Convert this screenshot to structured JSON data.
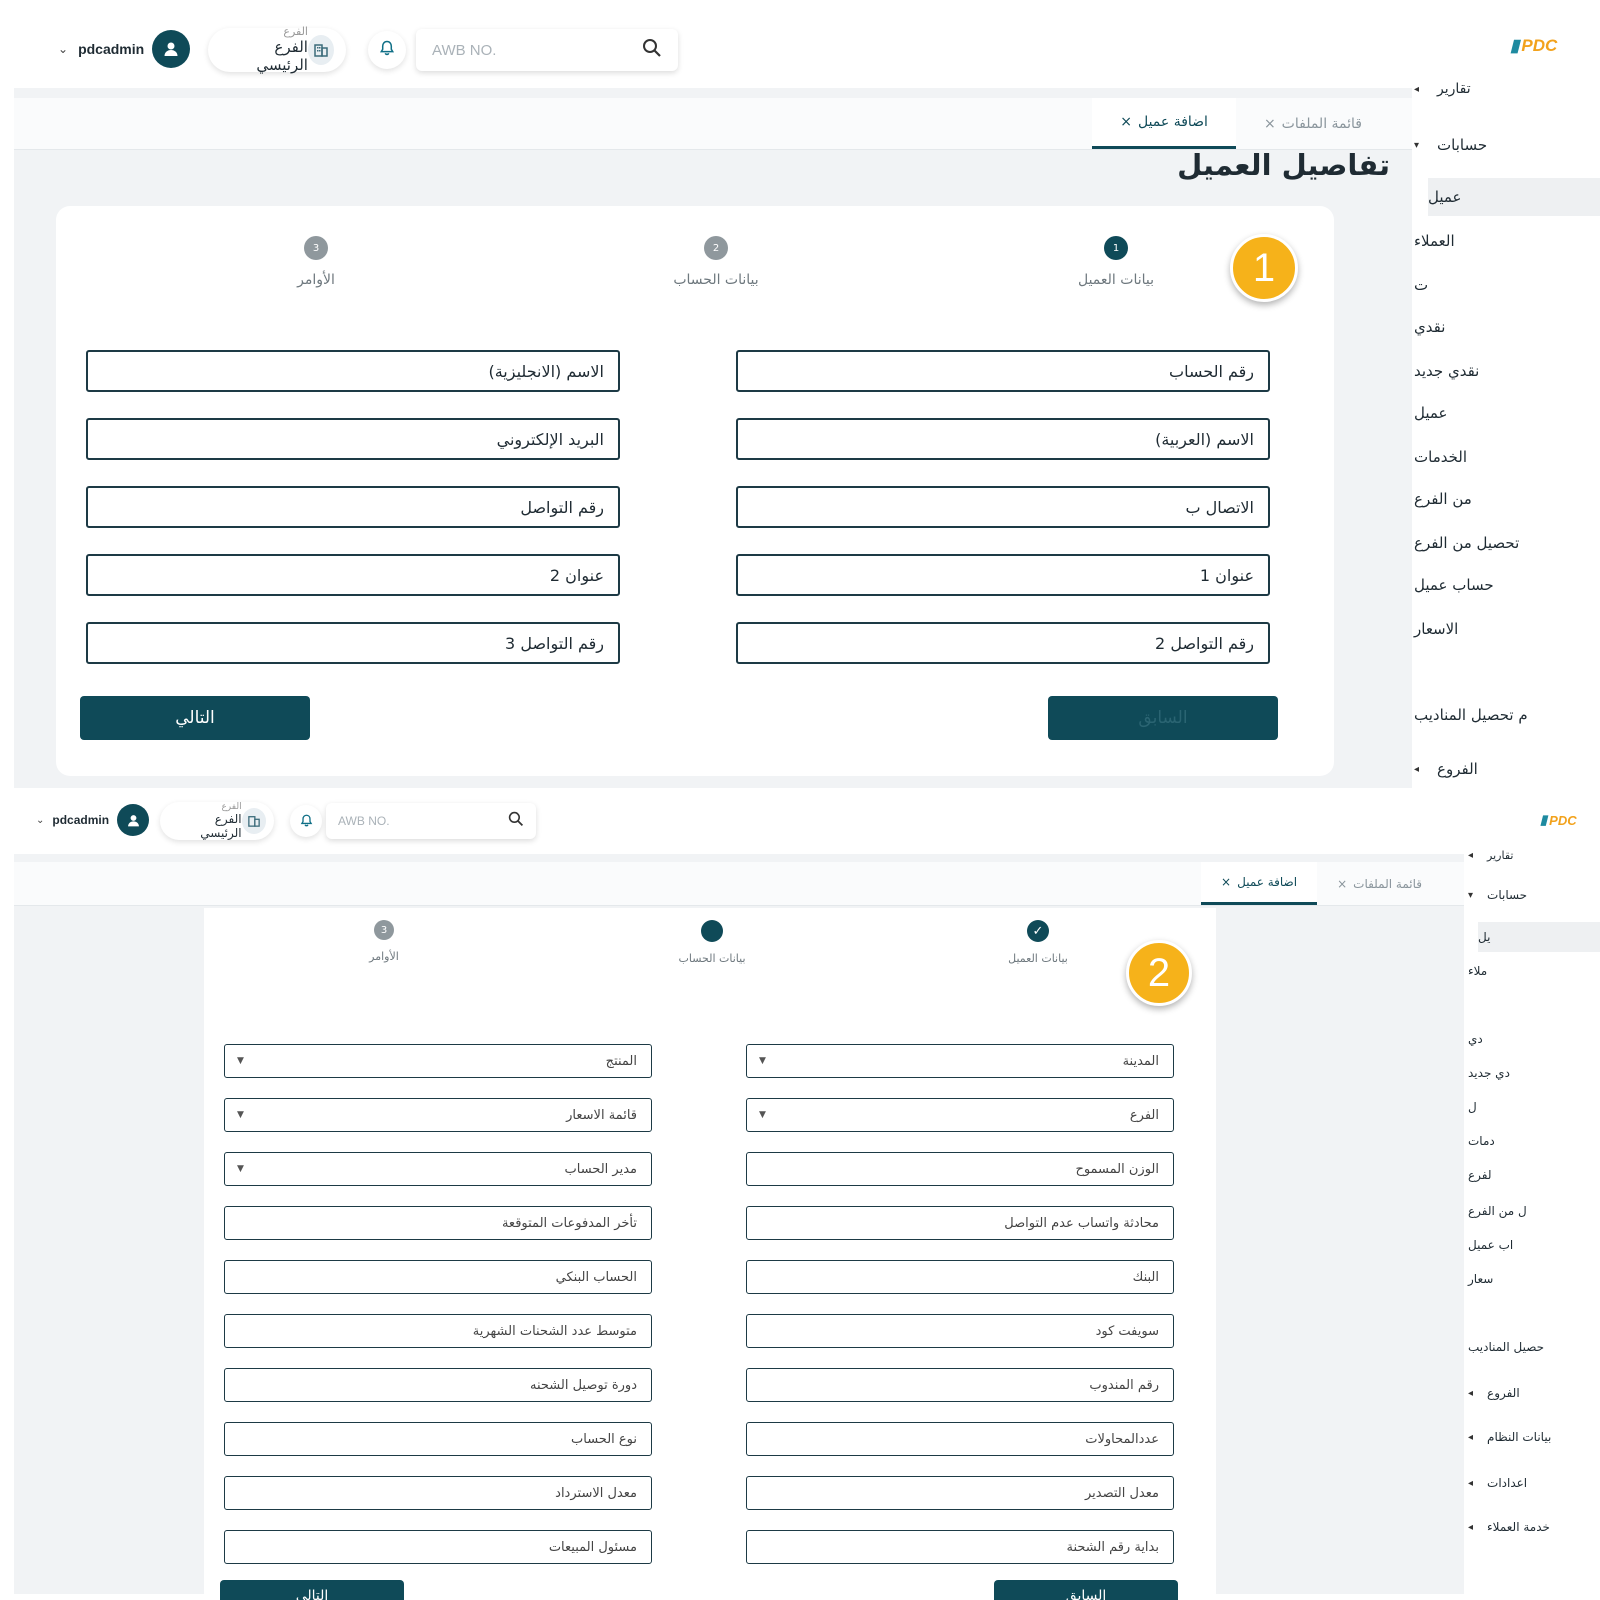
{
  "panels": [
    {
      "id": "1",
      "topbar": {
        "user": "pdcadmin",
        "branch_caption": "الفرع",
        "branch_value": "الفرع الرئيسي",
        "search_placeholder": "AWB NO.",
        "logo_text": "PDC"
      },
      "tabs": [
        {
          "label": "قائمة الملفات",
          "close": "×",
          "active": false
        },
        {
          "label": "اضافة عميل",
          "close": "×",
          "active": true
        }
      ],
      "page_title": "تفاصيل العميل",
      "badge": "1",
      "steps": [
        {
          "number": "1",
          "label": "بيانات العميل",
          "state": "current"
        },
        {
          "number": "2",
          "label": "بيانات الحساب",
          "state": "pending"
        },
        {
          "number": "3",
          "label": "الأوامر",
          "state": "pending"
        }
      ],
      "fields_right": [
        "رقم الحساب",
        "الاسم (العربية)",
        "الاتصال ب",
        "عنوان 1",
        "رقم التواصل 2"
      ],
      "fields_left": [
        "الاسم (الانجليزية)",
        "البريد الإلكتروني",
        "رقم التواصل",
        "عنوان 2",
        "رقم التواصل 3"
      ],
      "buttons": {
        "prev": "السابق",
        "next": "التالي"
      },
      "sidebar": [
        {
          "label": "تقارير",
          "arrow": "◂"
        },
        {
          "label": "حسابات",
          "arrow": "▾"
        },
        {
          "label": "عميل",
          "arrow": ""
        },
        {
          "label": "العملاء",
          "arrow": ""
        },
        {
          "label": "ت",
          "arrow": ""
        },
        {
          "label": "نقدي",
          "arrow": ""
        },
        {
          "label": "نقدي جديد",
          "arrow": ""
        },
        {
          "label": "عميل",
          "arrow": ""
        },
        {
          "label": "الخدمات",
          "arrow": ""
        },
        {
          "label": "من الفرع",
          "arrow": ""
        },
        {
          "label": "تحصيل من الفرع",
          "arrow": ""
        },
        {
          "label": "حساب عميل",
          "arrow": ""
        },
        {
          "label": "الاسعار",
          "arrow": ""
        },
        {
          "label": "م تحصيل المناديب",
          "arrow": ""
        },
        {
          "label": "الفروع",
          "arrow": "◂"
        }
      ]
    },
    {
      "id": "2",
      "topbar": {
        "user": "pdcadmin",
        "branch_caption": "الفرع",
        "branch_value": "الفرع الرئيسي",
        "search_placeholder": "AWB NO.",
        "logo_text": "PDC"
      },
      "tabs": [
        {
          "label": "قائمة الملفات",
          "close": "×",
          "active": false
        },
        {
          "label": "اضافة عميل",
          "close": "×",
          "active": true
        }
      ],
      "badge": "2",
      "steps": [
        {
          "number": "✓",
          "label": "بيانات العميل",
          "state": "done"
        },
        {
          "number": "",
          "label": "بيانات الحساب",
          "state": "current"
        },
        {
          "number": "3",
          "label": "الأوامر",
          "state": "pending"
        }
      ],
      "fields_right": [
        {
          "label": "المدينة",
          "dropdown": true
        },
        {
          "label": "الفرع",
          "dropdown": true
        },
        {
          "label": "الوزن المسموح",
          "dropdown": false
        },
        {
          "label": "محادثة واتساب عدم التواصل",
          "dropdown": false
        },
        {
          "label": "البنك",
          "dropdown": false
        },
        {
          "label": "سويفت كود",
          "dropdown": false
        },
        {
          "label": "رقم المندوب",
          "dropdown": false
        },
        {
          "label": "عددالمحاولات",
          "dropdown": false
        },
        {
          "label": "معدل التصدير",
          "dropdown": false
        },
        {
          "label": "بداية رقم الشحنة",
          "dropdown": false
        }
      ],
      "fields_left": [
        {
          "label": "المنتج",
          "dropdown": true
        },
        {
          "label": "قائمة الاسعار",
          "dropdown": true
        },
        {
          "label": "مدير الحساب",
          "dropdown": true
        },
        {
          "label": "تأخر المدفوعات المتوقعة",
          "dropdown": false
        },
        {
          "label": "الحساب البنكي",
          "dropdown": false
        },
        {
          "label": "متوسط عدد الشحنات الشهرية",
          "dropdown": false
        },
        {
          "label": "دورة توصيل الشحنه",
          "dropdown": false
        },
        {
          "label": "نوع الحساب",
          "dropdown": false
        },
        {
          "label": "معدل الاسترداد",
          "dropdown": false
        },
        {
          "label": "مسئول المبيعات",
          "dropdown": false
        }
      ],
      "buttons": {
        "prev": "السابق",
        "next": "التالي"
      },
      "sidebar": [
        {
          "label": "تقارير",
          "arrow": "◂"
        },
        {
          "label": "حسابات",
          "arrow": "▾"
        },
        {
          "label": "يل",
          "arrow": ""
        },
        {
          "label": "ملاء",
          "arrow": ""
        },
        {
          "label": "دي",
          "arrow": ""
        },
        {
          "label": "دي جديد",
          "arrow": ""
        },
        {
          "label": "ل",
          "arrow": ""
        },
        {
          "label": "دمات",
          "arrow": ""
        },
        {
          "label": "لفرع",
          "arrow": ""
        },
        {
          "label": "ل من الفرع",
          "arrow": ""
        },
        {
          "label": "اب عميل",
          "arrow": ""
        },
        {
          "label": "سعار",
          "arrow": ""
        },
        {
          "label": "حصيل المناديب",
          "arrow": ""
        },
        {
          "label": "الفروع",
          "arrow": "◂"
        },
        {
          "label": "بيانات النظام",
          "arrow": "◂"
        },
        {
          "label": "اعدادات",
          "arrow": "◂"
        },
        {
          "label": "خدمة العملاء",
          "arrow": "◂"
        }
      ]
    }
  ],
  "icons": {
    "user": "user-icon",
    "branch": "building-icon",
    "bell": "bell-icon",
    "search": "search-icon",
    "chevron": "chevron-down-icon"
  },
  "colors": {
    "primary": "#0f4a58",
    "badge": "#f6b21a",
    "logo": "#f2a21c"
  }
}
